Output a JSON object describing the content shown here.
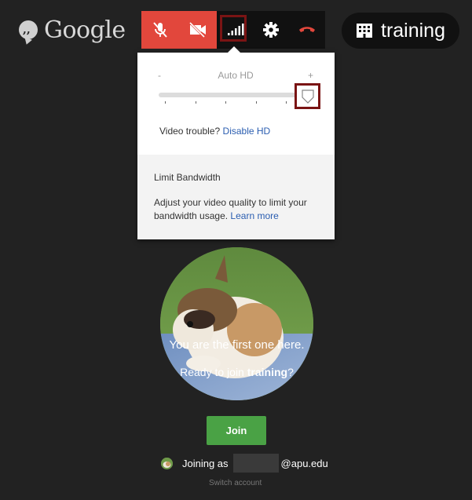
{
  "app": {
    "logo_text": "Google"
  },
  "toolbar": {
    "buttons": [
      {
        "icon": "microphone-muted-icon",
        "state": "muted"
      },
      {
        "icon": "camera-off-icon",
        "state": "off"
      },
      {
        "icon": "bandwidth-signal-icon",
        "state": "active"
      },
      {
        "icon": "gear-icon"
      },
      {
        "icon": "hang-up-icon"
      }
    ],
    "colors": {
      "muted_bg": "#e2473c",
      "dark_bg": "#111111",
      "hangup": "#e2473c"
    }
  },
  "room": {
    "name": "training",
    "icon": "building-icon"
  },
  "bandwidth_popup": {
    "slider": {
      "min_label": "-",
      "center_label": "Auto HD",
      "max_label": "+",
      "tick_count": 5,
      "level": 1.0
    },
    "trouble_text": "Video trouble?",
    "disable_hd_link": "Disable HD",
    "limit_title": "Limit Bandwidth",
    "limit_desc": "Adjust your video quality to limit your bandwidth usage.",
    "learn_more_link": "Learn more"
  },
  "lobby": {
    "first_line": "You are the first one here.",
    "ready_prefix": "Ready to join ",
    "ready_room": "training",
    "ready_suffix": "?",
    "join_label": "Join",
    "joining_prefix": "Joining as",
    "email_domain": "@apu.edu",
    "switch_account": "Switch account"
  },
  "accent": {
    "join_green": "#4aa245",
    "link_blue": "#2a5db0",
    "highlight": "#7a1414"
  }
}
